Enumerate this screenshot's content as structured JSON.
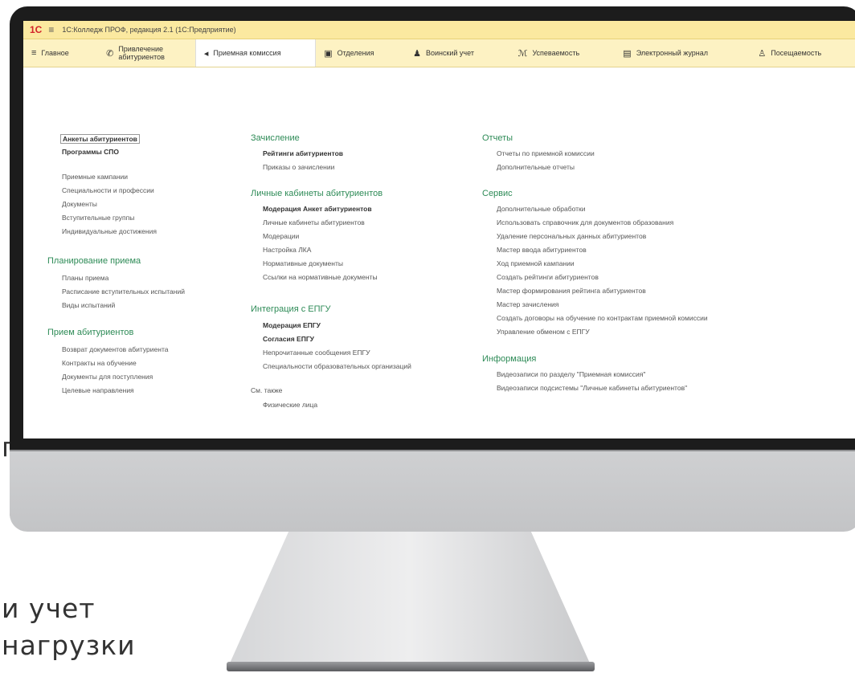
{
  "background": {
    "line1": "п",
    "line2": "и учет",
    "line3": "нагрузки"
  },
  "window": {
    "title": "1С:Колледж ПРОФ, редакция 2.1 (1С:Предприятие)",
    "logo": "1С"
  },
  "sections": [
    {
      "icon": "menu-icon",
      "glyph": "≡",
      "label": "Главное"
    },
    {
      "icon": "handshake-icon",
      "glyph": "✆",
      "label": "Привлечение абитуриентов"
    },
    {
      "icon": "flag-icon",
      "glyph": "◂",
      "label": "Приемная комиссия"
    },
    {
      "icon": "building-icon",
      "glyph": "▣",
      "label": "Отделения"
    },
    {
      "icon": "person-icon",
      "glyph": "♟",
      "label": "Воинский учет"
    },
    {
      "icon": "grades-icon",
      "glyph": "ℳ",
      "label": "Успеваемость"
    },
    {
      "icon": "journal-icon",
      "glyph": "▤",
      "label": "Электронный журнал"
    },
    {
      "icon": "attendance-icon",
      "glyph": "♙",
      "label": "Посещаемость"
    }
  ],
  "col1": {
    "top": [
      {
        "text": "Анкеты абитуриентов",
        "bold": true,
        "boxed": true
      },
      {
        "text": "Программы СПО",
        "bold": true
      }
    ],
    "links1": [
      "Приемные кампании",
      "Специальности и профессии",
      "Документы",
      "Вступительные группы",
      "Индивидуальные достижения"
    ],
    "group2": "Планирование приема",
    "links2": [
      "Планы приема",
      "Расписание вступительных испытаний",
      "Виды испытаний"
    ],
    "group3": "Прием абитуриентов",
    "links3": [
      "Возврат документов абитуриента",
      "Контракты на обучение",
      "Документы для поступления",
      "Целевые направления"
    ]
  },
  "col2": {
    "group1": "Зачисление",
    "links1": [
      {
        "text": "Рейтинги абитуриентов",
        "bold": true
      },
      {
        "text": "Приказы о зачислении"
      }
    ],
    "group2": "Личные кабинеты абитуриентов",
    "links2": [
      {
        "text": "Модерация Анкет абитуриентов",
        "bold": true
      },
      {
        "text": "Личные кабинеты абитуриентов"
      },
      {
        "text": "Модерации"
      },
      {
        "text": "Настройка ЛКА"
      },
      {
        "text": "Нормативные документы"
      },
      {
        "text": "Ссылки на нормативные документы"
      }
    ],
    "group3": "Интеграция с ЕПГУ",
    "links3": [
      {
        "text": "Модерация ЕПГУ",
        "bold": true
      },
      {
        "text": "Согласия ЕПГУ",
        "bold": true
      },
      {
        "text": "Непрочитанные сообщения ЕПГУ"
      },
      {
        "text": "Специальности образовательных организаций"
      }
    ],
    "see_also": "См. также",
    "see_also_link": "Физические лица"
  },
  "col3": {
    "group1": "Отчеты",
    "links1": [
      "Отчеты по приемной комиссии",
      "Дополнительные отчеты"
    ],
    "group2": "Сервис",
    "links2": [
      "Дополнительные обработки",
      "Использовать справочник для документов образования",
      "Удаление персональных данных абитуриентов",
      "Мастер ввода абитуриентов",
      "Ход приемной кампании",
      "Создать рейтинги абитуриентов",
      "Мастер формирования рейтинга абитуриентов",
      "Мастер зачисления",
      "Создать договоры на обучение по контрактам приемной комиссии",
      "Управление обменом с ЕПГУ"
    ],
    "group3": "Информация",
    "links3": [
      "Видеозаписи по разделу \"Приемная комиссия\"",
      "Видеозаписи подсистемы \"Личные кабинеты абитуриентов\""
    ]
  },
  "colors": {
    "titlebar": "#fbe9a0",
    "sectionbar": "#fdf2c3",
    "group_heading": "#2e8b57",
    "monitor_bezel": "#1c1c1c",
    "monitor_chin": "#c8c9cb"
  }
}
